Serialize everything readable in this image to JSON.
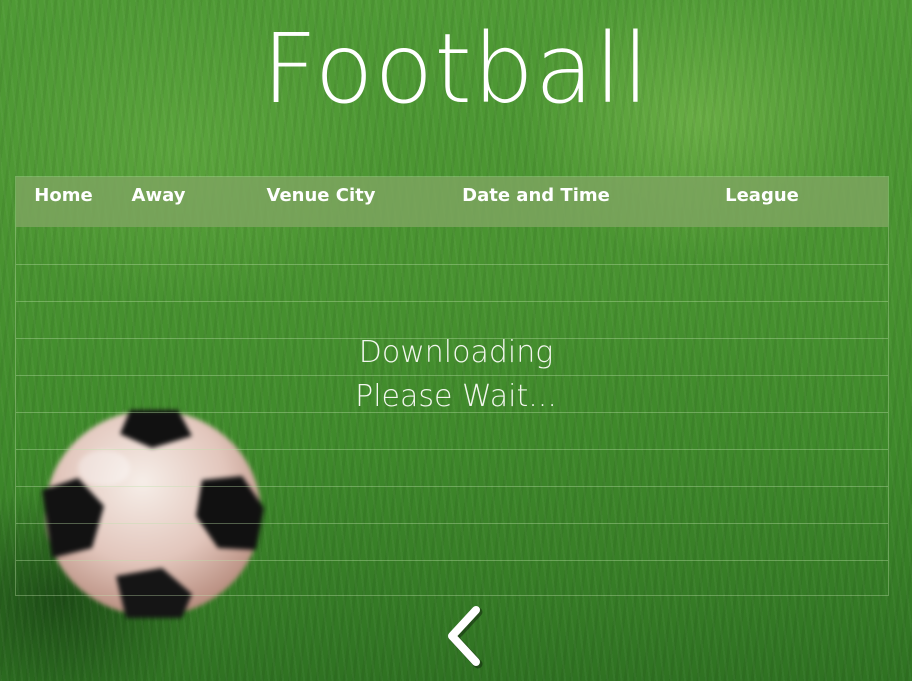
{
  "page": {
    "title": "Football"
  },
  "table": {
    "columns": [
      "Home",
      "Away",
      "Venue City",
      "Date and Time",
      "League"
    ],
    "rows": []
  },
  "status": {
    "line1": "Downloading",
    "line2": "Please Wait..."
  },
  "navigation": {
    "back_icon": "chevron-left-icon"
  },
  "colors": {
    "header_background": "#7da55f",
    "text": "#ffffff",
    "grass": "#4a9431"
  }
}
